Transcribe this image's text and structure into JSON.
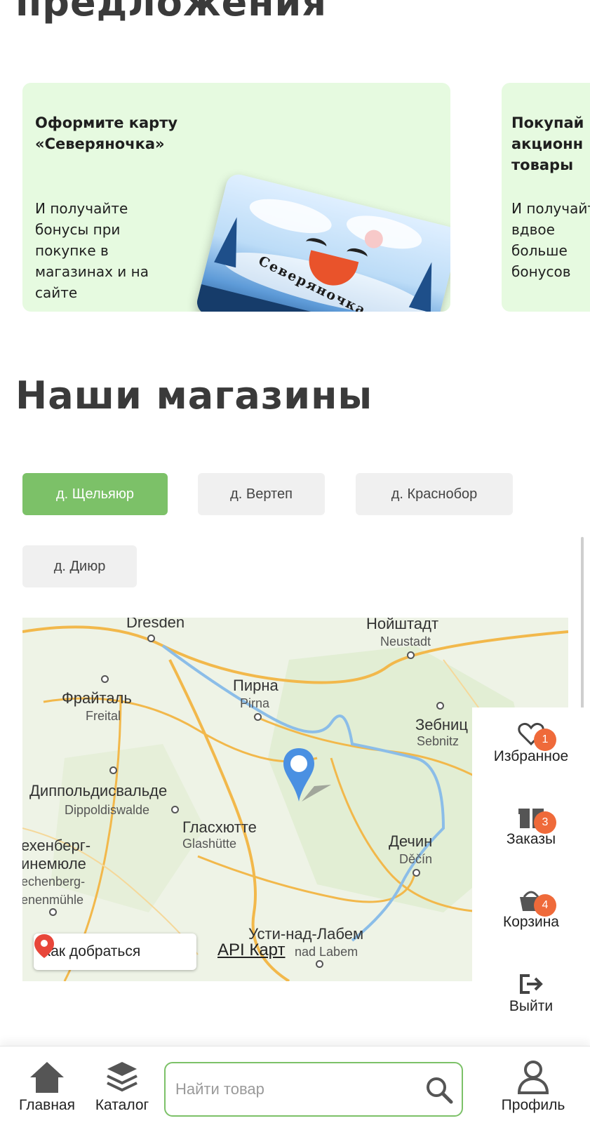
{
  "offers_section": {
    "title": "предложения"
  },
  "offers": [
    {
      "title": "Оформите карту «Северяночка»",
      "description": "И получайте бонусы при покупке в магазинах и на сайте",
      "card_brand": "Северяночка"
    },
    {
      "title": "Покупай акционн товары",
      "description": "И получайте вдвое больше бонусов"
    }
  ],
  "stores_section": {
    "title": "Наши магазины",
    "tabs": [
      {
        "label": "д. Щельяюр",
        "active": true
      },
      {
        "label": "д. Вертеп",
        "active": false
      },
      {
        "label": "д. Краснобор",
        "active": false
      },
      {
        "label": "д. Диюр",
        "active": false
      }
    ]
  },
  "map": {
    "labels": {
      "dresden": "Dresden",
      "neustadt_ru": "Нойштадт",
      "neustadt": "Neustadt",
      "pirna_ru": "Пирна",
      "pirna": "Pirna",
      "freital_ru": "Фрайталь",
      "freital": "Freital",
      "sebnitz_ru": "Зебниц",
      "sebnitz": "Sebnitz",
      "dippoldiswalde_ru": "Диппольдисвальде",
      "dippoldiswalde": "Dippoldiswalde",
      "glashuette_ru": "Гласхютте",
      "glashuette": "Glashütte",
      "altenberg_ru1": "ехенберг-",
      "altenberg_ru2": "инемюле",
      "altenberg1": "echenberg-",
      "altenberg2": "enenmühle",
      "decin_ru": "Дечин",
      "decin": "Děčín",
      "usti_ru": "Усти-над-Лабем",
      "usti": "nad Labem"
    },
    "route_button": "Как добраться",
    "api_link": "API Карт"
  },
  "side_panel": {
    "favorites": {
      "label": "Избранное",
      "badge": "1"
    },
    "orders": {
      "label": "Заказы",
      "badge": "3"
    },
    "cart": {
      "label": "Корзина",
      "badge": "4"
    },
    "logout": {
      "label": "Выйти"
    }
  },
  "bottom_nav": {
    "home": "Главная",
    "catalog": "Каталог",
    "search_placeholder": "Найти товар",
    "profile": "Профиль"
  },
  "colors": {
    "accent_green": "#7cc168",
    "offer_bg": "#e6fae0",
    "badge_orange": "#ef6a3a"
  }
}
